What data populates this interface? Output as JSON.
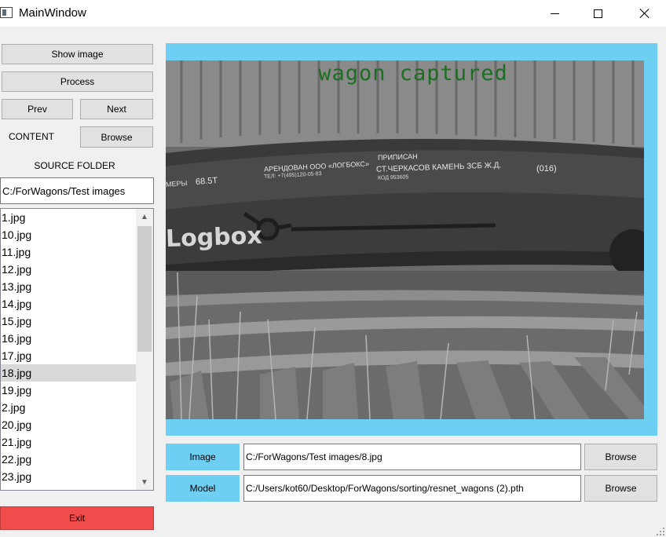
{
  "window": {
    "title": "MainWindow"
  },
  "left_panel": {
    "show_image_label": "Show image",
    "process_label": "Process",
    "prev_label": "Prev",
    "next_label": "Next",
    "content_label": "CONTENT",
    "browse_content_label": "Browse",
    "source_folder_label": "SOURCE FOLDER",
    "source_folder_value": "C:/ForWagons/Test images",
    "files": [
      "1.jpg",
      "10.jpg",
      "11.jpg",
      "12.jpg",
      "13.jpg",
      "14.jpg",
      "15.jpg",
      "16.jpg",
      "17.jpg",
      "18.jpg",
      "19.jpg",
      "2.jpg",
      "20.jpg",
      "21.jpg",
      "22.jpg",
      "23.jpg"
    ],
    "selected_file": "18.jpg",
    "exit_label": "Exit"
  },
  "viewer": {
    "caption": "wagon captured",
    "photo_texts": {
      "brand": "Logbox",
      "capacity": "68.5T",
      "owner_line1": "АРЕНДОВАН ООО «ЛОГБОКС»",
      "owner_line2": "ТЕЛ: +7(495)120-05-83",
      "assigned_line1": "ПРИПИСАН",
      "assigned_line2": "СТ.ЧЕРКАСОВ КАМЕНЬ ЗСБ Ж.Д.",
      "assigned_line3": "КОД 953605",
      "code_badge": "(016)",
      "left_mark": "МЕРЫ"
    }
  },
  "bottom": {
    "image_label": "Image",
    "image_path": "C:/ForWagons/Test images/8.jpg",
    "image_browse_label": "Browse",
    "model_label": "Model",
    "model_path": "C:/Users/kot60/Desktop/ForWagons/sorting/resnet_wagons (2).pth",
    "model_browse_label": "Browse"
  },
  "colors": {
    "accent_cyan": "#6fcff2",
    "exit_red": "#f04c4c",
    "caption_green": "#1d6e22"
  },
  "icons": {
    "app": "app-window-icon",
    "minimize": "minimize-icon",
    "maximize": "maximize-icon",
    "close": "close-icon",
    "scroll_up": "chevron-up-icon",
    "scroll_down": "chevron-down-icon"
  }
}
